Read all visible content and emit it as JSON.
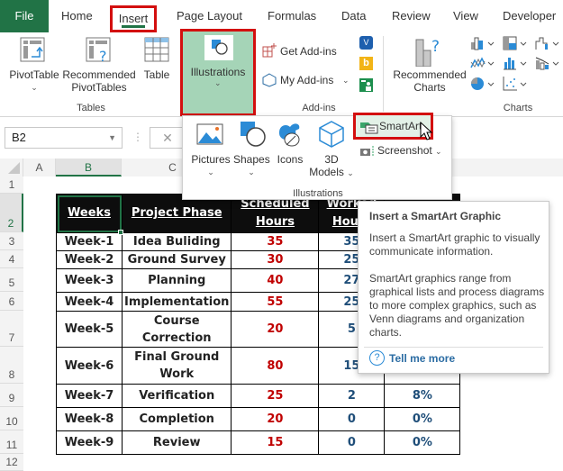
{
  "tabs": [
    {
      "label": "File",
      "active": false
    },
    {
      "label": "Home",
      "active": false
    },
    {
      "label": "Insert",
      "active": true
    },
    {
      "label": "Page Layout",
      "active": false
    },
    {
      "label": "Formulas",
      "active": false
    },
    {
      "label": "Data",
      "active": false
    },
    {
      "label": "Review",
      "active": false
    },
    {
      "label": "View",
      "active": false
    },
    {
      "label": "Developer",
      "active": false
    }
  ],
  "ribbon": {
    "tables_group": {
      "label": "Tables",
      "pivot_table": "PivotTable",
      "recommended_pivot_1": "Recommended",
      "recommended_pivot_2": "PivotTables",
      "table": "Table"
    },
    "illustrations_button": "Illustrations",
    "addins_group": {
      "label": "Add-ins",
      "get_addins": "Get Add-ins",
      "my_addins": "My Add-ins"
    },
    "charts_group": {
      "label": "Charts",
      "recommended_charts_1": "Recommended",
      "recommended_charts_2": "Charts"
    }
  },
  "illustrations_panel": {
    "pictures": "Pictures",
    "shapes": "Shapes",
    "icons": "Icons",
    "models_1": "3D",
    "models_2": "Models",
    "smartart": "SmartArt",
    "screenshot": "Screenshot",
    "group_label": "Illustrations"
  },
  "name_box": "B2",
  "columns": [
    "A",
    "B",
    "C"
  ],
  "rows": [
    "1",
    "2",
    "3",
    "4",
    "5",
    "6",
    "7",
    "8",
    "9",
    "10",
    "11",
    "12"
  ],
  "table": {
    "headers": [
      "Weeks",
      "Project Phase",
      "Scheduled Hours",
      "Worked Hours",
      ""
    ],
    "rows": [
      {
        "week": "Week-1",
        "phase": "Idea Buliding",
        "scheduled": "35",
        "worked": "35",
        "pct": ""
      },
      {
        "week": "Week-2",
        "phase": "Ground Survey",
        "scheduled": "30",
        "worked": "25",
        "pct": ""
      },
      {
        "week": "Week-3",
        "phase": "Planning",
        "scheduled": "40",
        "worked": "27",
        "pct": ""
      },
      {
        "week": "Week-4",
        "phase": "Implementation",
        "scheduled": "55",
        "worked": "25",
        "pct": ""
      },
      {
        "week": "Week-5",
        "phase": "Course Correction",
        "scheduled": "20",
        "worked": "5",
        "pct": ""
      },
      {
        "week": "Week-6",
        "phase": "Final Ground Work",
        "scheduled": "80",
        "worked": "15",
        "pct": ""
      },
      {
        "week": "Week-7",
        "phase": "Verification",
        "scheduled": "25",
        "worked": "2",
        "pct": "8%"
      },
      {
        "week": "Week-8",
        "phase": "Completion",
        "scheduled": "20",
        "worked": "0",
        "pct": "0%"
      },
      {
        "week": "Week-9",
        "phase": "Review",
        "scheduled": "15",
        "worked": "0",
        "pct": "0%"
      }
    ]
  },
  "tooltip": {
    "title": "Insert a SmartArt Graphic",
    "para1": "Insert a SmartArt graphic to visually communicate information.",
    "para2": "SmartArt graphics range from graphical lists and process diagrams to more complex graphics, such as Venn diagrams and organization charts.",
    "link": "Tell me more",
    "help_glyph": "?"
  },
  "colors": {
    "accent_green": "#217346",
    "highlight_red": "#d30f0f",
    "illustrations_bg": "#a5d4b7",
    "scheduled_text": "#c00000",
    "worked_text": "#1f4e79"
  }
}
